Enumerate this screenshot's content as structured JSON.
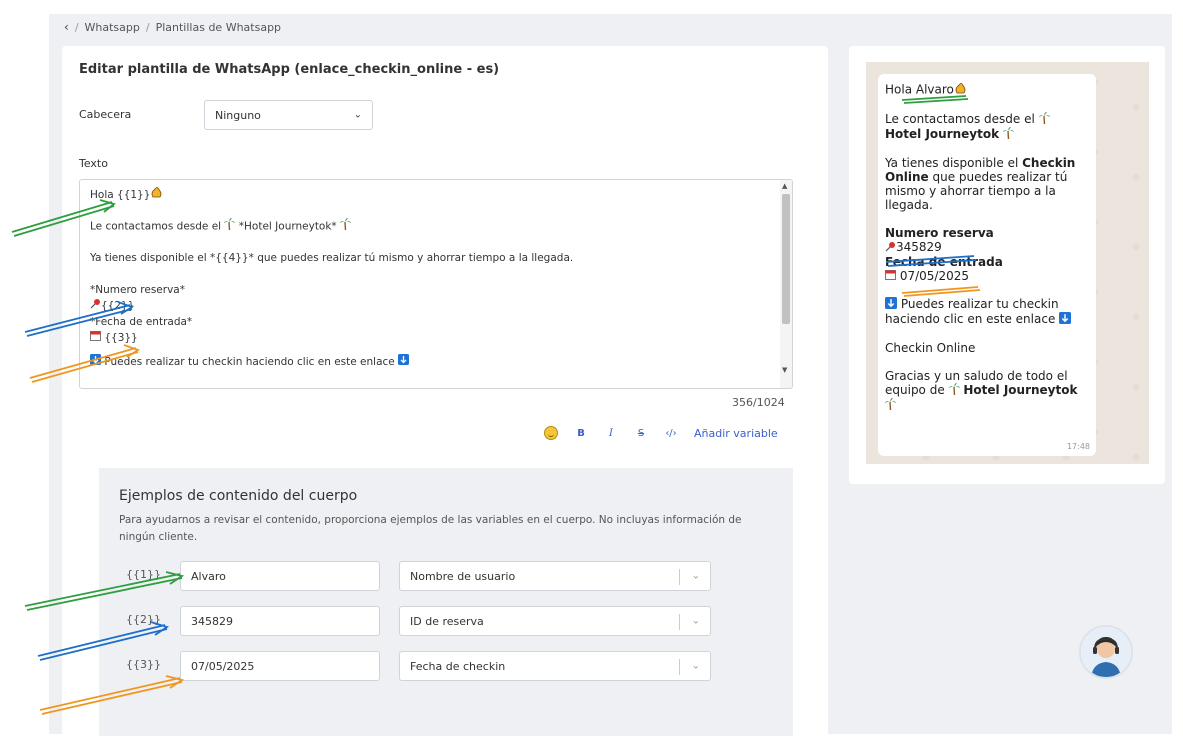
{
  "breadcrumb": {
    "back_icon": "chevron-left-icon",
    "sep": "/",
    "items": [
      "Whatsapp",
      "Plantillas de Whatsapp"
    ]
  },
  "editor": {
    "title": "Editar plantilla de WhatsApp (enlace_checkin_online - es)",
    "header_label": "Cabecera",
    "header_value": "Ninguno",
    "text_label": "Texto",
    "text_lines": {
      "l1": "Hola {{1}}",
      "l2a": "Le contactamos desde el ",
      "l2b": " *Hotel Journeytok* ",
      "l3": "Ya tienes disponible el *{{4}}* que puedes realizar tú mismo y ahorrar tiempo a la llegada.",
      "l4": "*Numero reserva*",
      "l5": "{{2}}",
      "l6": "*Fecha de entrada*",
      "l7": " {{3}}",
      "l8": " Puedes realizar tu checkin haciendo clic en este enlace "
    },
    "counter": "356/1024",
    "toolbar": {
      "bold": "B",
      "italic": "I",
      "strike": "S",
      "code": "‹/›",
      "add_variable": "Añadir variable"
    }
  },
  "examples": {
    "title": "Ejemplos de contenido del cuerpo",
    "description": "Para ayudarnos a revisar el contenido, proporciona ejemplos de las variables en el cuerpo. No incluyas información de ningún cliente.",
    "rows": [
      {
        "var": "{{1}}",
        "value": "Alvaro",
        "type": "Nombre de usuario"
      },
      {
        "var": "{{2}}",
        "value": "345829",
        "type": "ID de reserva"
      },
      {
        "var": "{{3}}",
        "value": "07/05/2025",
        "type": "Fecha de checkin"
      }
    ]
  },
  "preview": {
    "greeting": "Hola Alvaro",
    "contact_a": "Le contactamos desde el ",
    "hotel": "Hotel Journeytok",
    "available_a": "Ya tienes disponible el ",
    "checkin_bold": "Checkin Online",
    "available_b": " que puedes realizar tú mismo y ahorrar tiempo a la llegada.",
    "reserva_label": "Numero reserva",
    "reserva_value": "345829",
    "fecha_label": "Fecha de entrada",
    "fecha_value": "07/05/2025",
    "link_text": " Puedes realizar tu checkin haciendo clic en este enlace ",
    "checkin_link": "Checkin Online",
    "thanks": "Gracias y un saludo de todo el equipo de ",
    "time": "17:48"
  },
  "colors": {
    "accent": "#3a5fcd",
    "green_arrow": "#2e9e3e",
    "blue_arrow": "#1e6fc9",
    "orange_arrow": "#f0961e"
  }
}
